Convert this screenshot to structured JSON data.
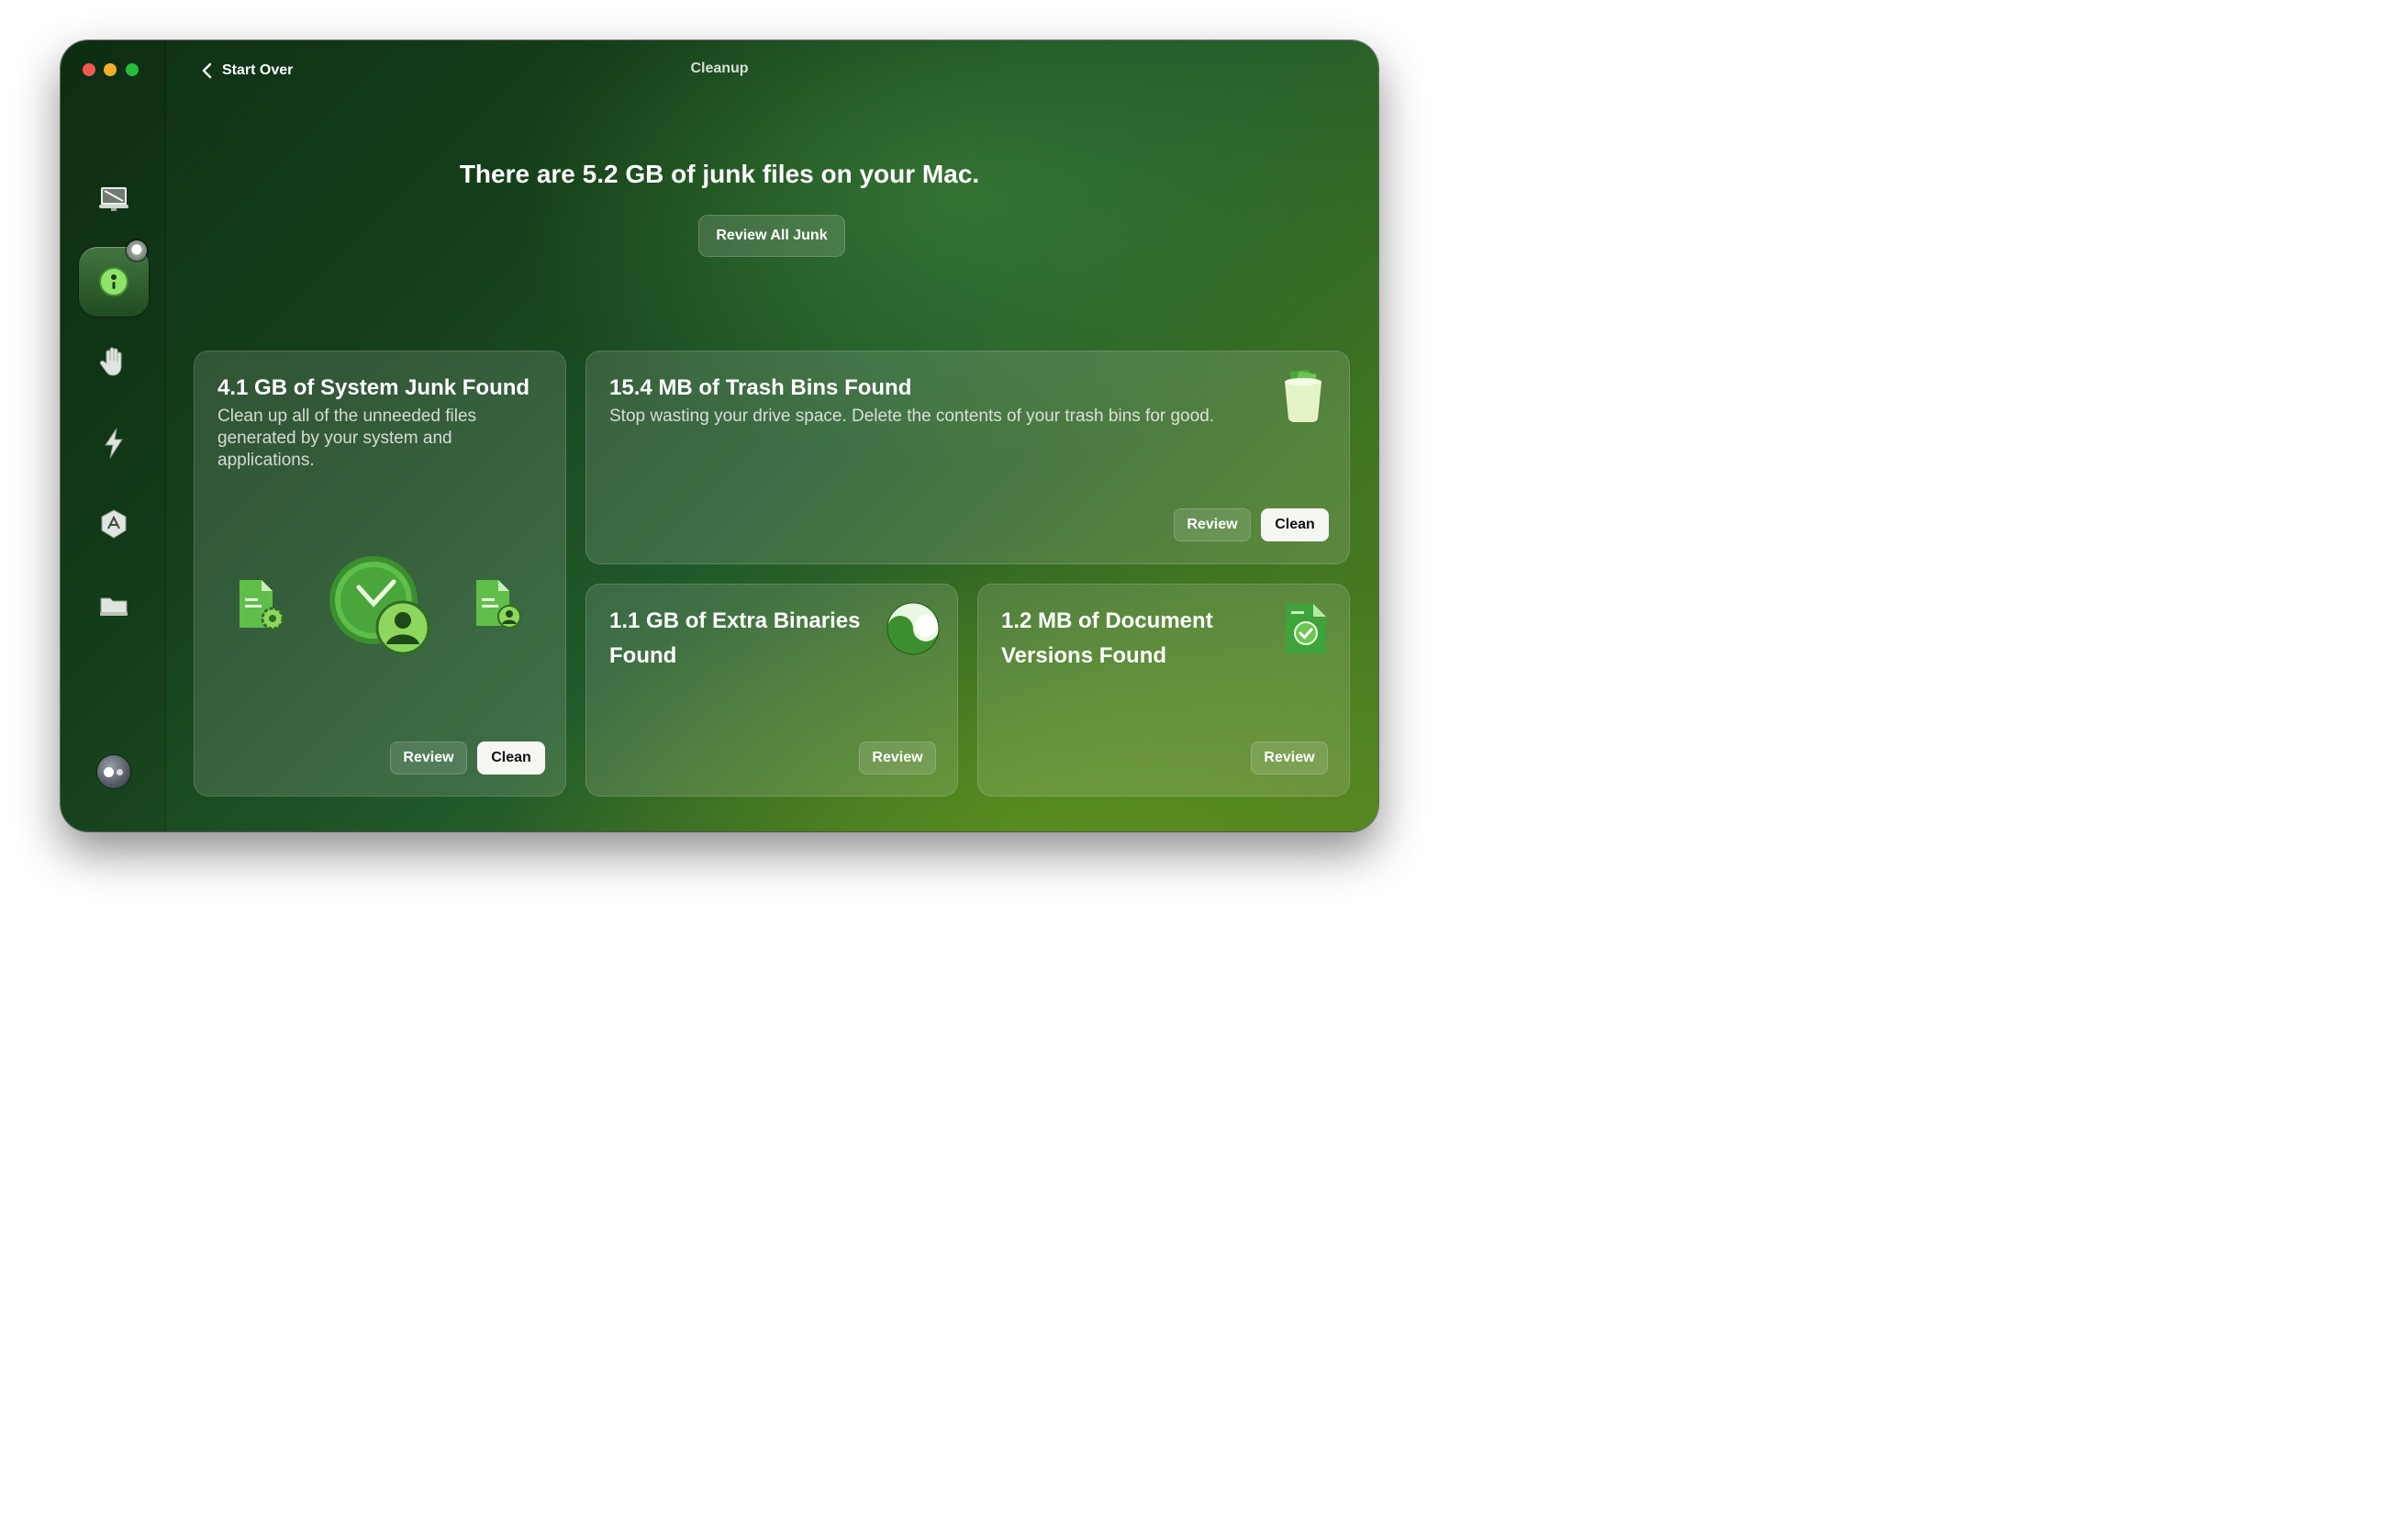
{
  "window": {
    "title": "Cleanup",
    "start_over_label": "Start Over"
  },
  "sidebar": {
    "items": [
      {
        "name": "smart-care",
        "icon": "monitor-icon"
      },
      {
        "name": "cleanup",
        "icon": "cleanup-icon",
        "active": true
      },
      {
        "name": "protection",
        "icon": "hand-icon"
      },
      {
        "name": "performance",
        "icon": "lightning-icon"
      },
      {
        "name": "applications",
        "icon": "app-store-icon"
      },
      {
        "name": "my-clutter",
        "icon": "folder-icon"
      }
    ],
    "assistant_icon": "assistant-icon"
  },
  "main": {
    "headline": "There are 5.2 GB of junk files on your Mac.",
    "review_all_label": "Review All Junk"
  },
  "cards": {
    "system_junk": {
      "title": "4.1 GB of System Junk Found",
      "description": "Clean up all of the unneeded files generated by your system and applications.",
      "review_label": "Review",
      "clean_label": "Clean"
    },
    "trash_bins": {
      "title": "15.4 MB of Trash Bins Found",
      "description": "Stop wasting your drive space. Delete the contents of your trash bins for good.",
      "review_label": "Review",
      "clean_label": "Clean"
    },
    "extra_binaries": {
      "title": "1.1 GB of Extra Binaries Found",
      "review_label": "Review"
    },
    "document_versions": {
      "title": "1.2 MB of Document Versions Found",
      "review_label": "Review"
    }
  },
  "colors": {
    "accent_green": "#4caf50",
    "close": "#ff5f57",
    "minimize": "#febc2e",
    "zoom": "#28c840"
  }
}
